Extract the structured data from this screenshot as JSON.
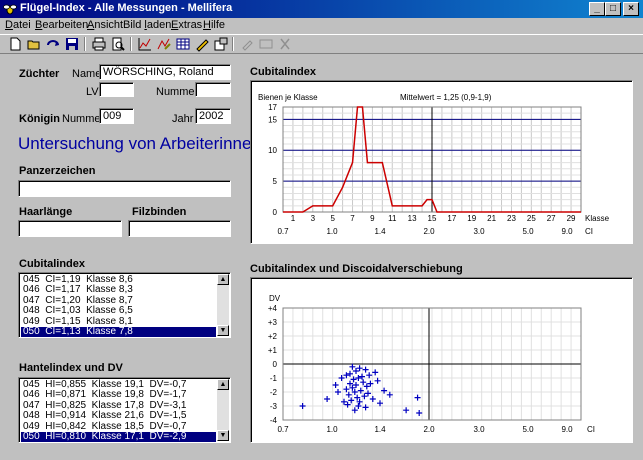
{
  "window": {
    "title": "Flügel-Index - Alle Messungen - Mellifera",
    "min": "_",
    "max": "□",
    "close": "×"
  },
  "menu": [
    {
      "pre": "",
      "u": "D",
      "post": "atei"
    },
    {
      "pre": "",
      "u": "B",
      "post": "earbeiten"
    },
    {
      "pre": "",
      "u": "A",
      "post": "nsicht"
    },
    {
      "pre": "Bild ",
      "u": "l",
      "post": "aden"
    },
    {
      "pre": "",
      "u": "E",
      "post": "xtras"
    },
    {
      "pre": "",
      "u": "H",
      "post": "ilfe"
    }
  ],
  "toolbar": [
    "new-icon",
    "open-icon",
    "refresh-icon",
    "save-icon",
    "print-icon",
    "print-preview-icon",
    "chart-icon",
    "edit-chart-icon",
    "table-icon",
    "pencil-icon",
    "settings-icon",
    "tool-disabled-icon",
    "window-disabled-icon",
    "close-disabled-icon"
  ],
  "form": {
    "zuechter_label": "Züchter",
    "name_label": "Name",
    "name_value": "WÖRSCHING, Roland",
    "lv_label": "LV",
    "lv_value": "",
    "nummer_label": "Nummer",
    "nummer_value": "",
    "koenigin_label": "Königin",
    "koenigin_nummer_label": "Nummer",
    "koenigin_nummer_value": "009",
    "jahr_label": "Jahr",
    "jahr_value": "2002",
    "heading": "Untersuchung von Arbeiterinnen",
    "panzer_label": "Panzerzeichen",
    "panzer_value": "",
    "haar_label": "Haarlänge",
    "haar_value": "",
    "filz_label": "Filzbinden",
    "filz_value": "",
    "cubital_list_label": "Cubitalindex",
    "cubital_rows": [
      "045  CI=1,19  Klasse 8,6",
      "046  CI=1,17  Klasse 8,3",
      "047  CI=1,20  Klasse 8,7",
      "048  CI=1,03  Klasse 6,5",
      "049  CI=1,15  Klasse 8,1",
      "050  CI=1,13  Klasse 7,8"
    ],
    "hantel_list_label": "Hantelindex und DV",
    "hantel_rows": [
      "045  HI=0,855  Klasse 19,1  DV=-0,7",
      "046  HI=0,871  Klasse 19,8  DV=-1,7",
      "047  HI=0,825  Klasse 17,8  DV=-3,1",
      "048  HI=0,914  Klasse 21,6  DV=-1,5",
      "049  HI=0,842  Klasse 18,5  DV=-0,7",
      "050  HI=0,810  Klasse 17,1  DV=-2,9"
    ]
  },
  "chart1_label": "Cubitalindex",
  "chart2_label": "Cubitalindex und Discoidalverschiebung",
  "chart_data": [
    {
      "type": "line",
      "ylabel": "Bienen je Klasse",
      "annotation": "Mittelwert = 1,25 (0,9-1,9)",
      "xlabel": "Klasse",
      "x_ticks": [
        "1",
        "3",
        "5",
        "7",
        "9",
        "11",
        "13",
        "15",
        "17",
        "19",
        "21",
        "23",
        "25",
        "27",
        "29"
      ],
      "secondary_xlabel": "CI",
      "secondary_ticks": [
        "0.7",
        "1.0",
        "1.4",
        "2.0",
        "3.0",
        "5.0",
        "9.0"
      ],
      "y_ticks": [
        "0",
        "5",
        "10",
        "15",
        "17"
      ],
      "ylim": [
        0,
        17
      ],
      "xlim": [
        0,
        30
      ],
      "mean_class": 15,
      "color": "#cc0000",
      "x": [
        0,
        1,
        2,
        3,
        4,
        5,
        6,
        7,
        7.5,
        8,
        8.5,
        9,
        10,
        11,
        12,
        13,
        13.5,
        14,
        14.5,
        15,
        15.5,
        16,
        17,
        18,
        19,
        20,
        21,
        22,
        23,
        24,
        25,
        26,
        27,
        28,
        29,
        30
      ],
      "y": [
        0,
        0,
        0,
        1,
        1,
        1,
        4,
        8,
        17,
        17,
        8,
        8,
        8,
        1,
        1,
        1,
        1,
        1,
        2,
        2,
        0,
        0,
        0,
        0,
        0,
        0,
        0,
        0,
        0,
        0,
        0,
        0,
        0,
        0,
        0,
        0
      ]
    },
    {
      "type": "scatter",
      "ylabel": "DV",
      "y_ticks": [
        "+4",
        "+3",
        "+2",
        "+1",
        "0",
        "-1",
        "-2",
        "-3",
        "-4"
      ],
      "ylim": [
        -4,
        4
      ],
      "x_ticks": [
        "0.7",
        "1.0",
        "1.4",
        "2.0",
        "3.0",
        "5.0",
        "9.0"
      ],
      "xlabel": "CI",
      "marker": "+",
      "color": "#0000c0",
      "points": [
        [
          0.82,
          -3.0
        ],
        [
          0.97,
          -2.5
        ],
        [
          1.03,
          -1.5
        ],
        [
          1.05,
          -2.0
        ],
        [
          1.08,
          -1.0
        ],
        [
          1.1,
          -2.7
        ],
        [
          1.12,
          -0.8
        ],
        [
          1.12,
          -1.8
        ],
        [
          1.13,
          -2.9
        ],
        [
          1.14,
          -2.2
        ],
        [
          1.15,
          -0.7
        ],
        [
          1.15,
          -1.4
        ],
        [
          1.16,
          -2.6
        ],
        [
          1.17,
          -1.7
        ],
        [
          1.17,
          -0.2
        ],
        [
          1.18,
          -1.1
        ],
        [
          1.19,
          -2.0
        ],
        [
          1.19,
          -3.3
        ],
        [
          1.2,
          -0.5
        ],
        [
          1.2,
          -1.5
        ],
        [
          1.21,
          -2.4
        ],
        [
          1.22,
          -3.0
        ],
        [
          1.22,
          -1.0
        ],
        [
          1.23,
          -0.3
        ],
        [
          1.23,
          -2.7
        ],
        [
          1.24,
          -1.9
        ],
        [
          1.25,
          -0.9
        ],
        [
          1.26,
          -1.3
        ],
        [
          1.27,
          -2.3
        ],
        [
          1.28,
          -0.4
        ],
        [
          1.28,
          -3.1
        ],
        [
          1.29,
          -1.6
        ],
        [
          1.3,
          -2.1
        ],
        [
          1.31,
          -0.8
        ],
        [
          1.32,
          -1.4
        ],
        [
          1.34,
          -2.5
        ],
        [
          1.36,
          -0.6
        ],
        [
          1.38,
          -1.2
        ],
        [
          1.4,
          -2.8
        ],
        [
          1.45,
          -1.9
        ],
        [
          1.52,
          -2.2
        ],
        [
          1.72,
          -3.3
        ],
        [
          1.86,
          -2.4
        ],
        [
          1.88,
          -3.5
        ]
      ]
    }
  ]
}
